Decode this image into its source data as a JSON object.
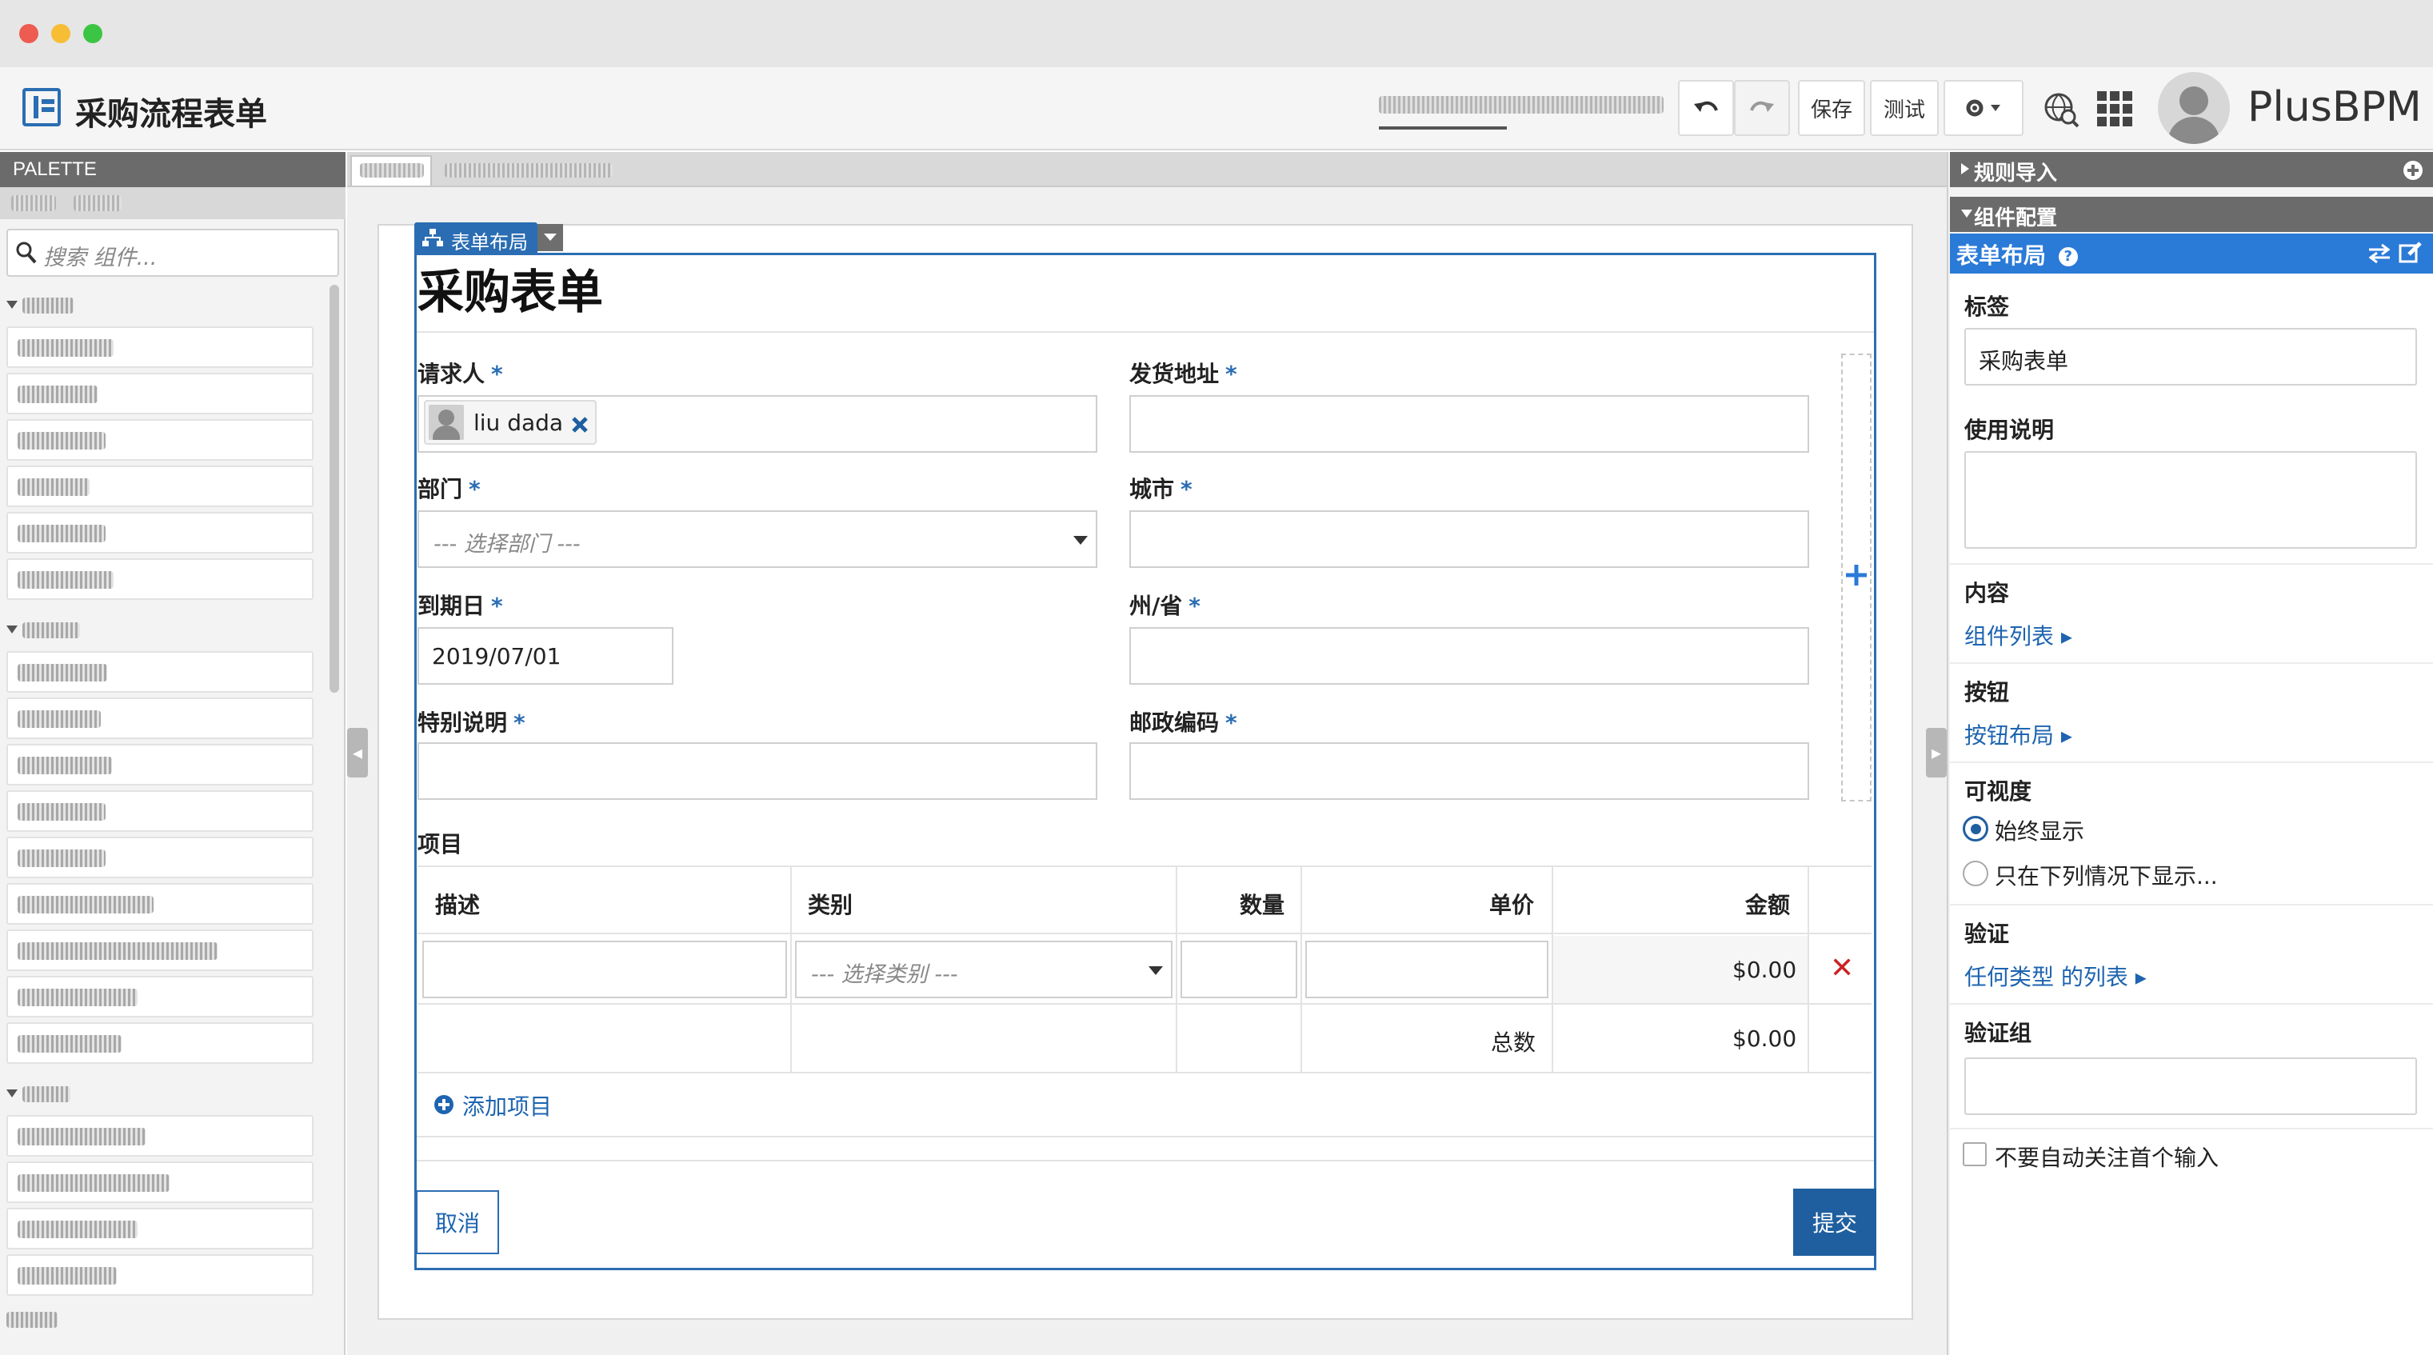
{
  "window": {
    "close": "#ee5b51",
    "minimize": "#f7bd35",
    "maximize": "#3cc544"
  },
  "header": {
    "title": "采购流程表单",
    "undo_icon": "undo-icon",
    "redo_icon": "redo-icon",
    "save": "保存",
    "test": "测试",
    "settings_icon": "gear-icon",
    "globe_icon": "globe-search-icon",
    "apps_icon": "grid-icon",
    "brand": "PlusBPM"
  },
  "palette": {
    "title": "PALETTE",
    "search_placeholder": "搜索 组件..."
  },
  "form": {
    "layout_tag": "表单布局",
    "title": "采购表单",
    "fields": {
      "requester": {
        "label": "请求人",
        "required": "*",
        "value": "liu dada"
      },
      "department": {
        "label": "部门",
        "required": "*",
        "placeholder": "--- 选择部门 ---"
      },
      "due_date": {
        "label": "到期日",
        "required": "*",
        "value": "2019/07/01"
      },
      "special_notes": {
        "label": "特别说明",
        "required": "*"
      },
      "ship_address": {
        "label": "发货地址",
        "required": "*"
      },
      "city": {
        "label": "城市",
        "required": "*"
      },
      "state": {
        "label": "州/省",
        "required": "*"
      },
      "postal": {
        "label": "邮政编码",
        "required": "*"
      }
    },
    "items": {
      "label": "项目",
      "columns": [
        "描述",
        "类别",
        "数量",
        "单价",
        "金额"
      ],
      "row": {
        "category_placeholder": "--- 选择类别 ---",
        "amount": "$0.00",
        "delete": "✕"
      },
      "total_label": "总数",
      "total_value": "$0.00",
      "add_item": "添加项目"
    },
    "cancel": "取消",
    "submit": "提交"
  },
  "right_panel": {
    "rules_import": "规则导入",
    "component_config": "组件配置",
    "selected": "表单布局",
    "help": "?",
    "label_title": "标签",
    "label_value": "采购表单",
    "usage_title": "使用说明",
    "content_title": "内容",
    "content_link": "组件列表",
    "buttons_title": "按钮",
    "buttons_link": "按钮布局",
    "visibility_title": "可视度",
    "visibility_always": "始终显示",
    "visibility_conditional": "只在下列情况下显示...",
    "validation_title": "验证",
    "validation_link": "任何类型 的列表",
    "validation_group_title": "验证组",
    "no_autofocus": "不要自动关注首个输入"
  }
}
